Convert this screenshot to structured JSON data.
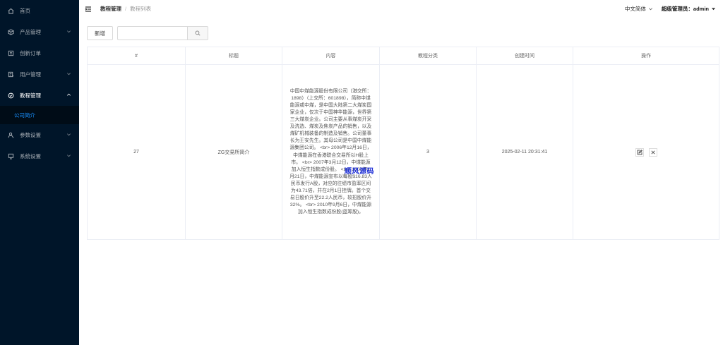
{
  "sidebar": {
    "items": [
      {
        "label": "首页",
        "icon": "home-icon"
      },
      {
        "label": "产品管理",
        "icon": "cube-icon"
      },
      {
        "label": "创新订单",
        "icon": "calendar-icon"
      },
      {
        "label": "用户管理",
        "icon": "user-list-icon"
      },
      {
        "label": "教程管理",
        "icon": "check-circle-icon"
      },
      {
        "label": "参数设置",
        "icon": "person-icon"
      },
      {
        "label": "系统设置",
        "icon": "monitor-icon"
      }
    ],
    "submenu_items": [
      {
        "label": "公司简介"
      }
    ]
  },
  "header": {
    "breadcrumb_parent": "教程管理",
    "breadcrumb_sep": "/",
    "breadcrumb_current": "教程列表",
    "language": "中文简体",
    "user_label": "超级管理员：admin"
  },
  "toolbar": {
    "add_label": "新增",
    "search_value": "",
    "search_placeholder": ""
  },
  "table": {
    "columns": [
      "#",
      "标题",
      "内容",
      "教程分类",
      "创建时间",
      "操作"
    ],
    "rows": [
      {
        "id": "27",
        "title": "ZG交易所简介",
        "content": "中国中煤能源股份有限公司（港交所：1898）（上交所：601898），简称中煤能源或中煤，是中国大陆第二大煤炭国家企业，仅次于中国神华能源，世界第三大煤炭企业。公司主要从事煤炭开采及洗选、煤炭及焦炭产品的销售，以及煤矿机械装备的制造及销售。公司董事长为王安先生。其母公司是中国中煤能源集团公司。 <br> 2006年12月16日，中煤能源在香港联合交易所以H股上市。 <br> 2007年3月12日，中煤能源加入恒生指数成份股。 <br> 2008年1月21日，中煤能源宣布以每股$16.83人民币发行A股，对应的往绩市盈率区间为43.71倍，并在2月1日挂牌。首个交易日股价升至22.2人民币，较招股价升32%。 <br> 2010年9月6日，中煤能源加入恒生指数成份股(蓝筹股)。",
        "category": "3",
        "created_at": "2025-02-11 20:31:41"
      }
    ]
  },
  "watermark": "顺风源码"
}
